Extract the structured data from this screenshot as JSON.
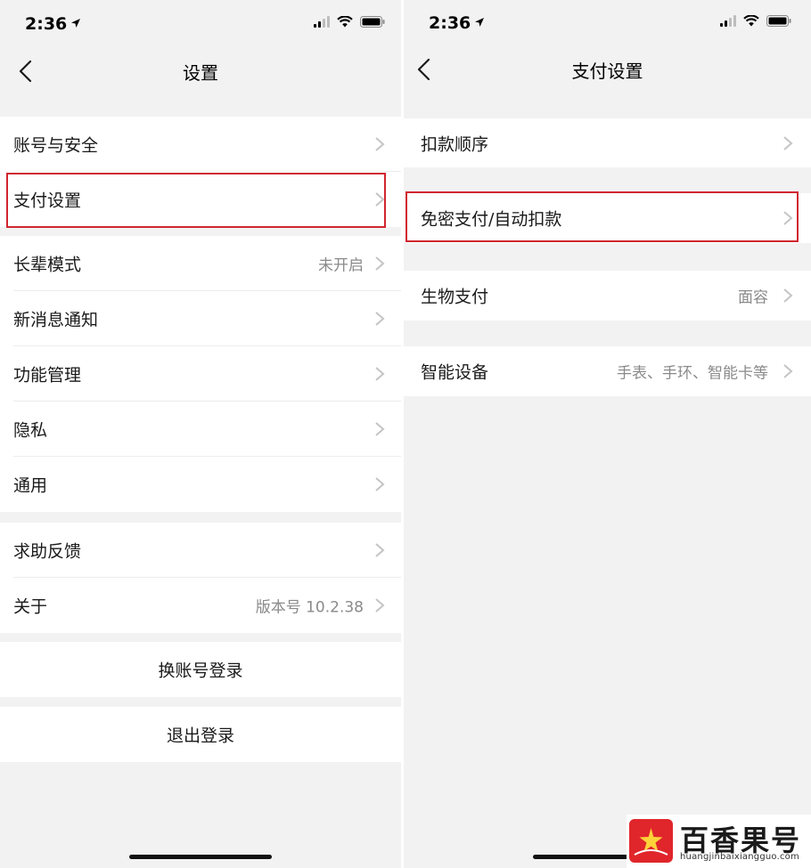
{
  "left": {
    "status": {
      "time": "2:36"
    },
    "nav": {
      "title": "设置"
    },
    "rows": {
      "account_security": {
        "label": "账号与安全"
      },
      "payment_settings": {
        "label": "支付设置"
      },
      "elder_mode": {
        "label": "长辈模式",
        "value": "未开启"
      },
      "notifications": {
        "label": "新消息通知"
      },
      "features": {
        "label": "功能管理"
      },
      "privacy": {
        "label": "隐私"
      },
      "general": {
        "label": "通用"
      },
      "help": {
        "label": "求助反馈"
      },
      "about": {
        "label": "关于",
        "value": "版本号 10.2.38"
      }
    },
    "actions": {
      "switch_account": "换账号登录",
      "logout": "退出登录"
    }
  },
  "right": {
    "status": {
      "time": "2:36"
    },
    "nav": {
      "title": "支付设置"
    },
    "rows": {
      "deduction_order": {
        "label": "扣款顺序"
      },
      "password_free": {
        "label": "免密支付/自动扣款"
      },
      "biometric": {
        "label": "生物支付",
        "value": "面容"
      },
      "smart_devices": {
        "label": "智能设备",
        "value": "手表、手环、智能卡等"
      }
    }
  },
  "watermark": {
    "brand": "百香果号",
    "domain": "huangjinbaixiangguo.com"
  },
  "colors": {
    "highlight": "#d0262f",
    "background": "#f2f2f2",
    "chevron": "#c4c4c4"
  }
}
